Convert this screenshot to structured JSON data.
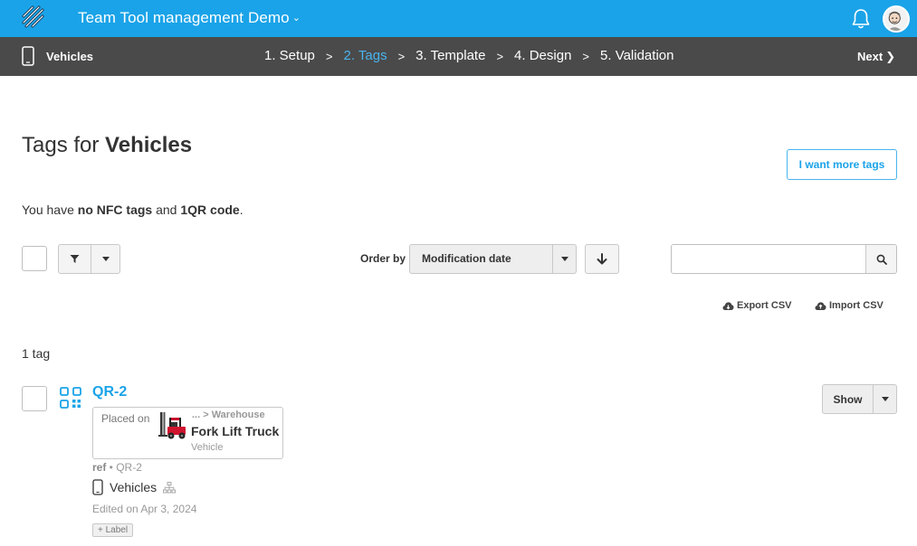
{
  "topbar": {
    "app_title": "Team Tool management Demo",
    "title_chevron": "⌄",
    "bell_icon": "bell-icon",
    "avatar_icon": "user-avatar"
  },
  "stepbar": {
    "section_label": "Vehicles",
    "steps": [
      {
        "label": "1. Setup",
        "active": false
      },
      {
        "label": "2. Tags",
        "active": true
      },
      {
        "label": "3. Template",
        "active": false
      },
      {
        "label": "4. Design",
        "active": false
      },
      {
        "label": "5. Validation",
        "active": false
      }
    ],
    "separator": ">",
    "next_label": "Next",
    "next_arrow": "❯"
  },
  "main": {
    "title_prefix": "Tags for ",
    "title_strong": "Vehicles",
    "more_tags_label": "I want more tags",
    "summary": {
      "part1": "You have ",
      "nfc": "no NFC tags",
      "part2": " and ",
      "qr": "1QR code",
      "part3": "."
    },
    "order_label": "Order by",
    "order_value": "Modification date",
    "search_placeholder": "",
    "export_csv": "Export CSV",
    "import_csv": "Import CSV",
    "count": "1 tag"
  },
  "tag": {
    "name": "QR-2",
    "placed_on": "Placed on",
    "breadcrumb": "... > Warehouse",
    "asset_name": "Fork Lift Truck",
    "asset_type": "Vehicle",
    "ref_label": "ref",
    "ref_value": " • QR-2",
    "category": "Vehicles",
    "edited": "Edited on Apr 3, 2024",
    "add_label": "+ Label",
    "show_label": "Show"
  },
  "colors": {
    "topbar": "#1aa3e8",
    "stepbar": "#4a4a4a",
    "accent": "#1aa3e8",
    "active_step": "#49b4ee"
  }
}
